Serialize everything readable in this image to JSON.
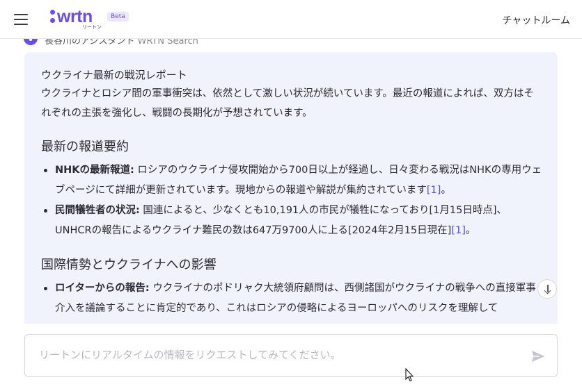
{
  "header": {
    "logo_text": "wrtn",
    "logo_sub": "リートン",
    "beta_label": "Beta",
    "chatroom_label": "チャットルーム"
  },
  "assistant": {
    "name": "長谷川のアシスタント",
    "tool": "WRTN Search"
  },
  "answer": {
    "report_title": "ウクライナ最新の戦況レポート",
    "intro": "ウクライナとロシア間の軍事衝突は、依然として激しい状況が続いています。最近の報道によれば、双方はそれぞれの主張を強化し、戦闘の長期化が予想されています。",
    "sections": [
      {
        "heading": "最新の報道要約",
        "items": [
          {
            "label": "NHKの最新報道:",
            "text": " ロシアのウクライナ侵攻開始から700日以上が経過し、日々変わる戦況はNHKの専用ウェブページにて詳細が更新されています。現地からの報道や解説が集約されています",
            "cite": "[1]",
            "tail": "。"
          },
          {
            "label": "民間犠牲者の状況:",
            "text": " 国連によると、少なくとも10,191人の市民が犠牲になっており[1月15日時点]、UNHCRの報告によるウクライナ難民の数は647万9700人に上る[2024年2月15日現在]",
            "cite": "[1]",
            "tail": "。"
          }
        ]
      },
      {
        "heading": "国際情勢とウクライナへの影響",
        "items": [
          {
            "label": "ロイターからの報告:",
            "text": " ウクライナのポドリャク大統領府顧問は、西側諸国がウクライナの戦争への直接軍事介入を議論することに肯定的であり、これはロシアの侵略によるヨーロッパへのリスクを理解して",
            "cite": "",
            "tail": ""
          }
        ]
      }
    ]
  },
  "input": {
    "placeholder": "リートンにリアルタイムの情報をリクエストしてみてください。",
    "value": ""
  },
  "colors": {
    "accent": "#6a4df0",
    "card_bg": "#f0f3fb"
  }
}
